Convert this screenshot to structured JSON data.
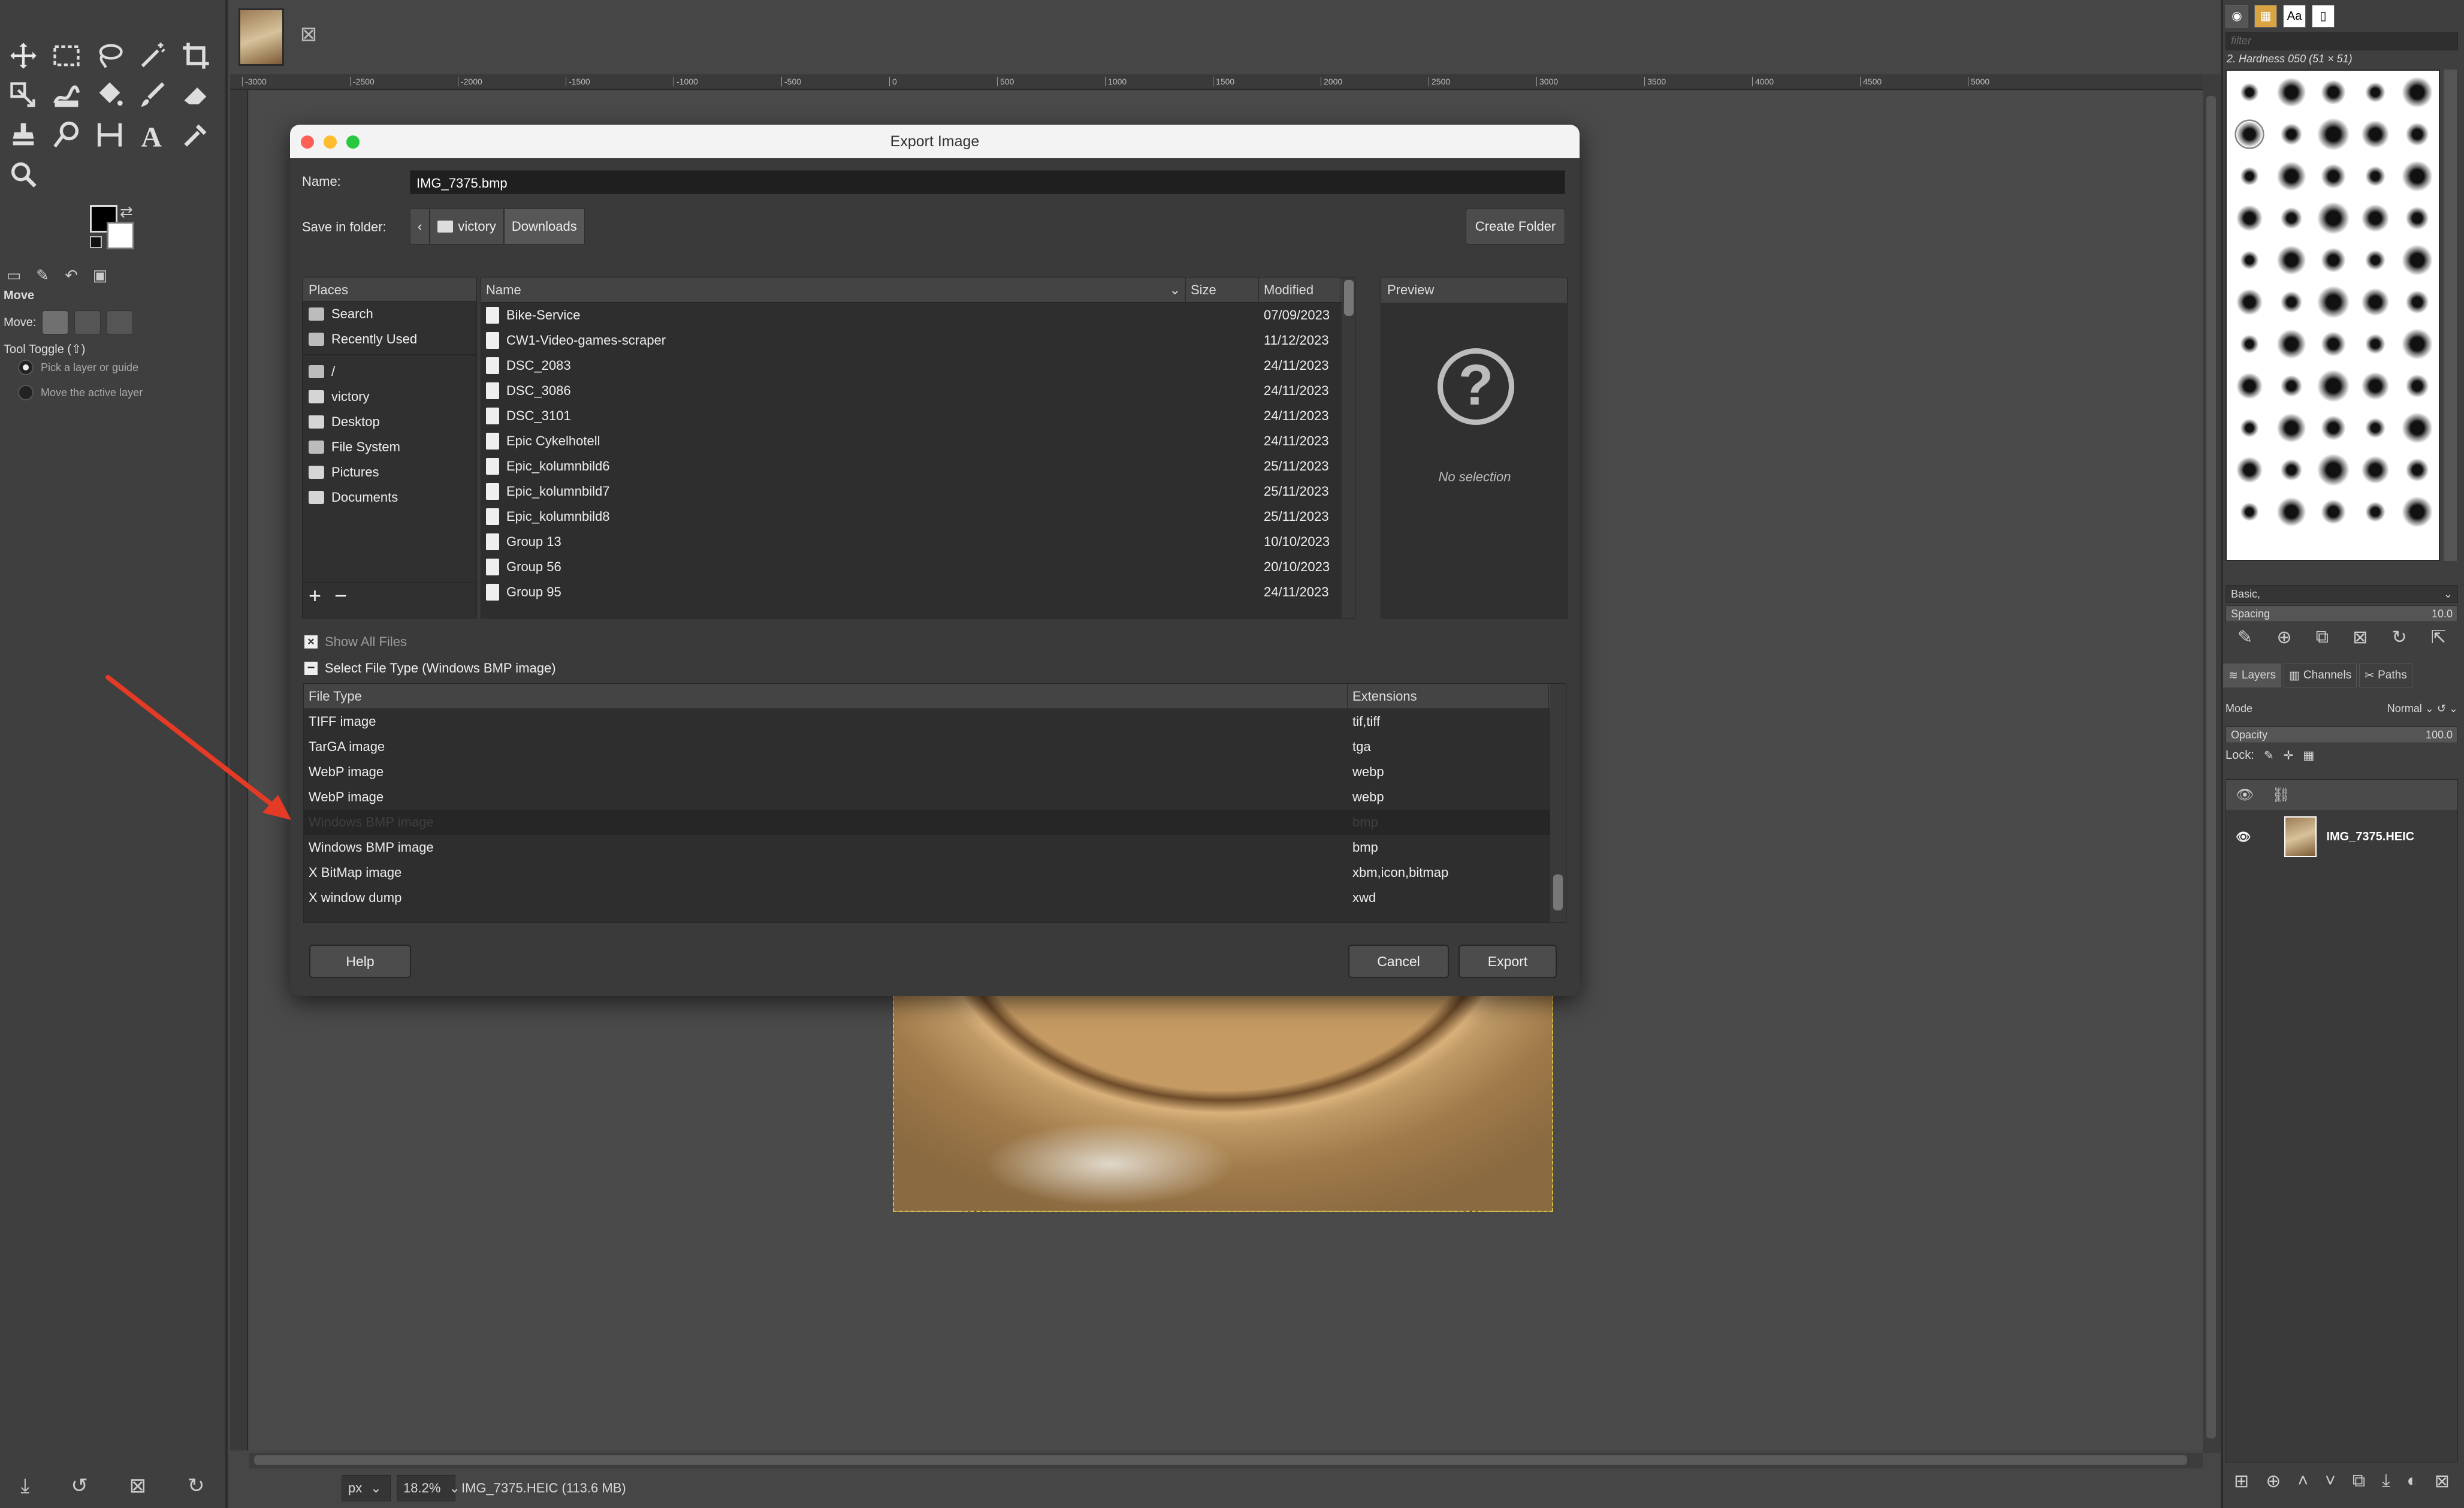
{
  "colors": {
    "accent_red": "#e53a26",
    "dialog_bg": "#3a3a3a",
    "titlebar": "#f3f3f3"
  },
  "toolbox": {
    "tools": [
      "move-icon",
      "rect-select-icon",
      "lasso-icon",
      "fuzzy-select-icon",
      "crop-icon",
      "transform-icon",
      "warp-icon",
      "bucket-fill-icon",
      "paintbrush-icon",
      "eraser-icon",
      "clone-icon",
      "smudge-icon",
      "measure-icon",
      "text-icon",
      "color-picker-icon",
      "zoom-icon"
    ],
    "tool_options": {
      "title": "Move",
      "move_label": "Move:",
      "toggle_label": "Tool Toggle  (⇧)",
      "radio1": "Pick a layer or guide",
      "radio2": "Move the active layer"
    }
  },
  "status": {
    "unit": "px",
    "zoom": "18.2%",
    "info": "IMG_7375.HEIC (113.6 MB)"
  },
  "ruler_ticks": [
    "-3000",
    "-2500",
    "-2000",
    "-1500",
    "-1000",
    "-500",
    "0",
    "500",
    "1000",
    "1500",
    "2000",
    "2500",
    "3000",
    "3500",
    "4000",
    "4500",
    "5000"
  ],
  "dock": {
    "filter_placeholder": "filter",
    "brush_title": "2. Hardness 050 (51 × 51)",
    "brush_set": "Basic,",
    "spacing_label": "Spacing",
    "spacing_value": "10.0",
    "tabs": {
      "layers": "Layers",
      "channels": "Channels",
      "paths": "Paths"
    },
    "mode_label": "Mode",
    "mode_value": "Normal",
    "opacity_label": "Opacity",
    "opacity_value": "100.0",
    "lock_label": "Lock:",
    "layer_name": "IMG_7375.HEIC"
  },
  "dialog": {
    "title": "Export Image",
    "name_label": "Name:",
    "name_value": "IMG_7375.bmp",
    "folder_label": "Save in folder:",
    "crumbs": [
      "victory",
      "Downloads"
    ],
    "create_folder": "Create Folder",
    "places_header": "Places",
    "places": [
      {
        "label": "Search",
        "icon": "search-icon"
      },
      {
        "label": "Recently Used",
        "icon": "recent-icon"
      },
      {
        "label": "/",
        "icon": "file-icon"
      },
      {
        "label": "victory",
        "icon": "folder-icon"
      },
      {
        "label": "Desktop",
        "icon": "folder-icon"
      },
      {
        "label": "File System",
        "icon": "disk-icon"
      },
      {
        "label": "Pictures",
        "icon": "folder-icon"
      },
      {
        "label": "Documents",
        "icon": "folder-icon"
      }
    ],
    "columns": {
      "name": "Name",
      "size": "Size",
      "modified": "Modified"
    },
    "files": [
      {
        "name": "Bike-Service",
        "modified": "07/09/2023"
      },
      {
        "name": "CW1-Video-games-scraper",
        "modified": "11/12/2023"
      },
      {
        "name": "DSC_2083",
        "modified": "24/11/2023"
      },
      {
        "name": "DSC_3086",
        "modified": "24/11/2023"
      },
      {
        "name": "DSC_3101",
        "modified": "24/11/2023"
      },
      {
        "name": "Epic Cykelhotell",
        "modified": "24/11/2023"
      },
      {
        "name": "Epic_kolumnbild6",
        "modified": "25/11/2023"
      },
      {
        "name": "Epic_kolumnbild7",
        "modified": "25/11/2023"
      },
      {
        "name": "Epic_kolumnbild8",
        "modified": "25/11/2023"
      },
      {
        "name": "Group 13",
        "modified": "10/10/2023"
      },
      {
        "name": "Group 56",
        "modified": "20/10/2023"
      },
      {
        "name": "Group 95",
        "modified": "24/11/2023"
      }
    ],
    "preview_header": "Preview",
    "no_selection": "No selection",
    "show_all_files": "Show All Files",
    "select_file_type": "Select File Type (Windows BMP image)",
    "ftype_columns": {
      "type": "File Type",
      "ext": "Extensions"
    },
    "file_types": [
      {
        "type": "TIFF image",
        "ext": "tif,tiff"
      },
      {
        "type": "TarGA image",
        "ext": "tga"
      },
      {
        "type": "WebP image",
        "ext": "webp"
      },
      {
        "type": "WebP image",
        "ext": "webp"
      },
      {
        "type": "Windows BMP image",
        "ext": "bmp"
      },
      {
        "type": "Windows BMP image",
        "ext": "bmp"
      },
      {
        "type": "X BitMap image",
        "ext": "xbm,icon,bitmap"
      },
      {
        "type": "X window dump",
        "ext": "xwd"
      }
    ],
    "help": "Help",
    "cancel": "Cancel",
    "export": "Export"
  }
}
